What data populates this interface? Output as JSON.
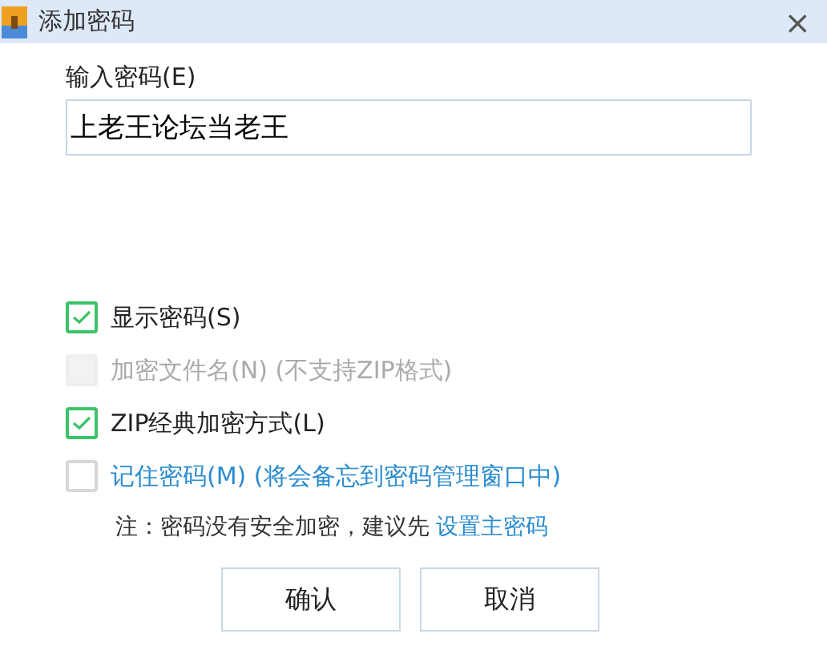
{
  "window": {
    "title": "添加密码",
    "close": "×"
  },
  "password": {
    "label": "输入密码(E)",
    "value": "上老王论坛当老王"
  },
  "options": [
    {
      "label": "显示密码(S)",
      "checked": true,
      "disabled": false,
      "kind": "plain"
    },
    {
      "label": "加密文件名(N) (不支持ZIP格式)",
      "checked": false,
      "disabled": true,
      "kind": "plain"
    },
    {
      "label": "ZIP经典加密方式(L)",
      "checked": true,
      "disabled": false,
      "kind": "plain"
    },
    {
      "label": "记住密码(M) (将会备忘到密码管理窗口中)",
      "checked": false,
      "disabled": false,
      "kind": "link"
    }
  ],
  "note": {
    "text": "注：密码没有安全加密，建议先",
    "link": "设置主密码"
  },
  "buttons": [
    "确认",
    "取消"
  ]
}
